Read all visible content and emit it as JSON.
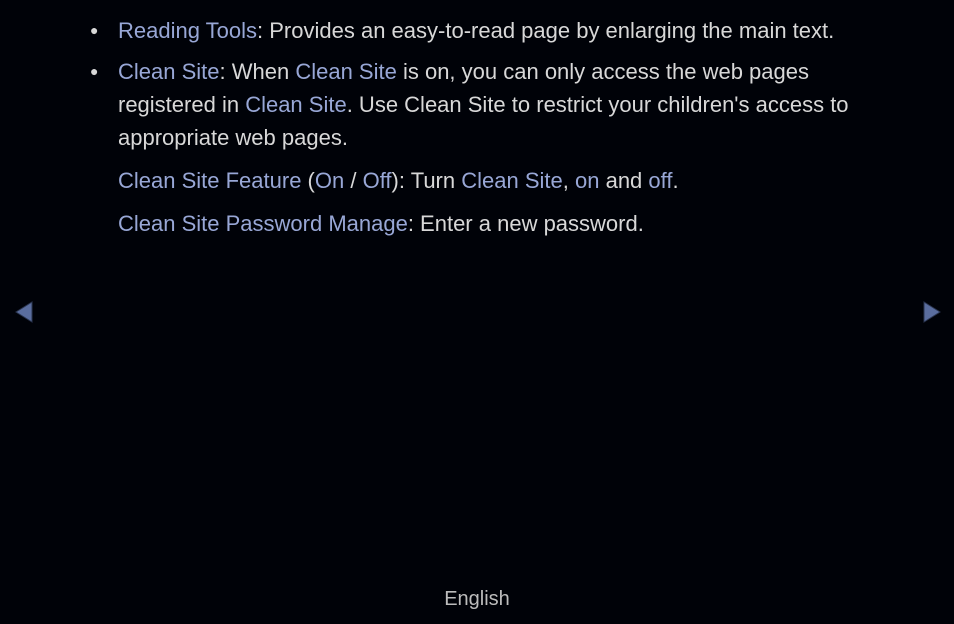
{
  "bullet1": {
    "term": "Reading Tools",
    "desc": ": Provides an easy-to-read page by enlarging the main text."
  },
  "bullet2": {
    "term": "Clean Site",
    "pre": ": When ",
    "cs1": "Clean Site",
    "mid1": " is on, you can only access the web pages registered in ",
    "cs2": "Clean Site",
    "post": ". Use Clean Site to restrict your children's access to appropriate web pages."
  },
  "para1": {
    "term": "Clean Site Feature",
    "p1": " (",
    "on": "On",
    "slash": " / ",
    "off": "Off",
    "p2": "): Turn ",
    "cs": "Clean Site",
    "p3": ", ",
    "on2": "on",
    "p4": " and ",
    "off2": "off",
    "p5": "."
  },
  "para2": {
    "term": "Clean Site Password Manage",
    "desc": ": Enter a new password."
  },
  "footer": "English"
}
